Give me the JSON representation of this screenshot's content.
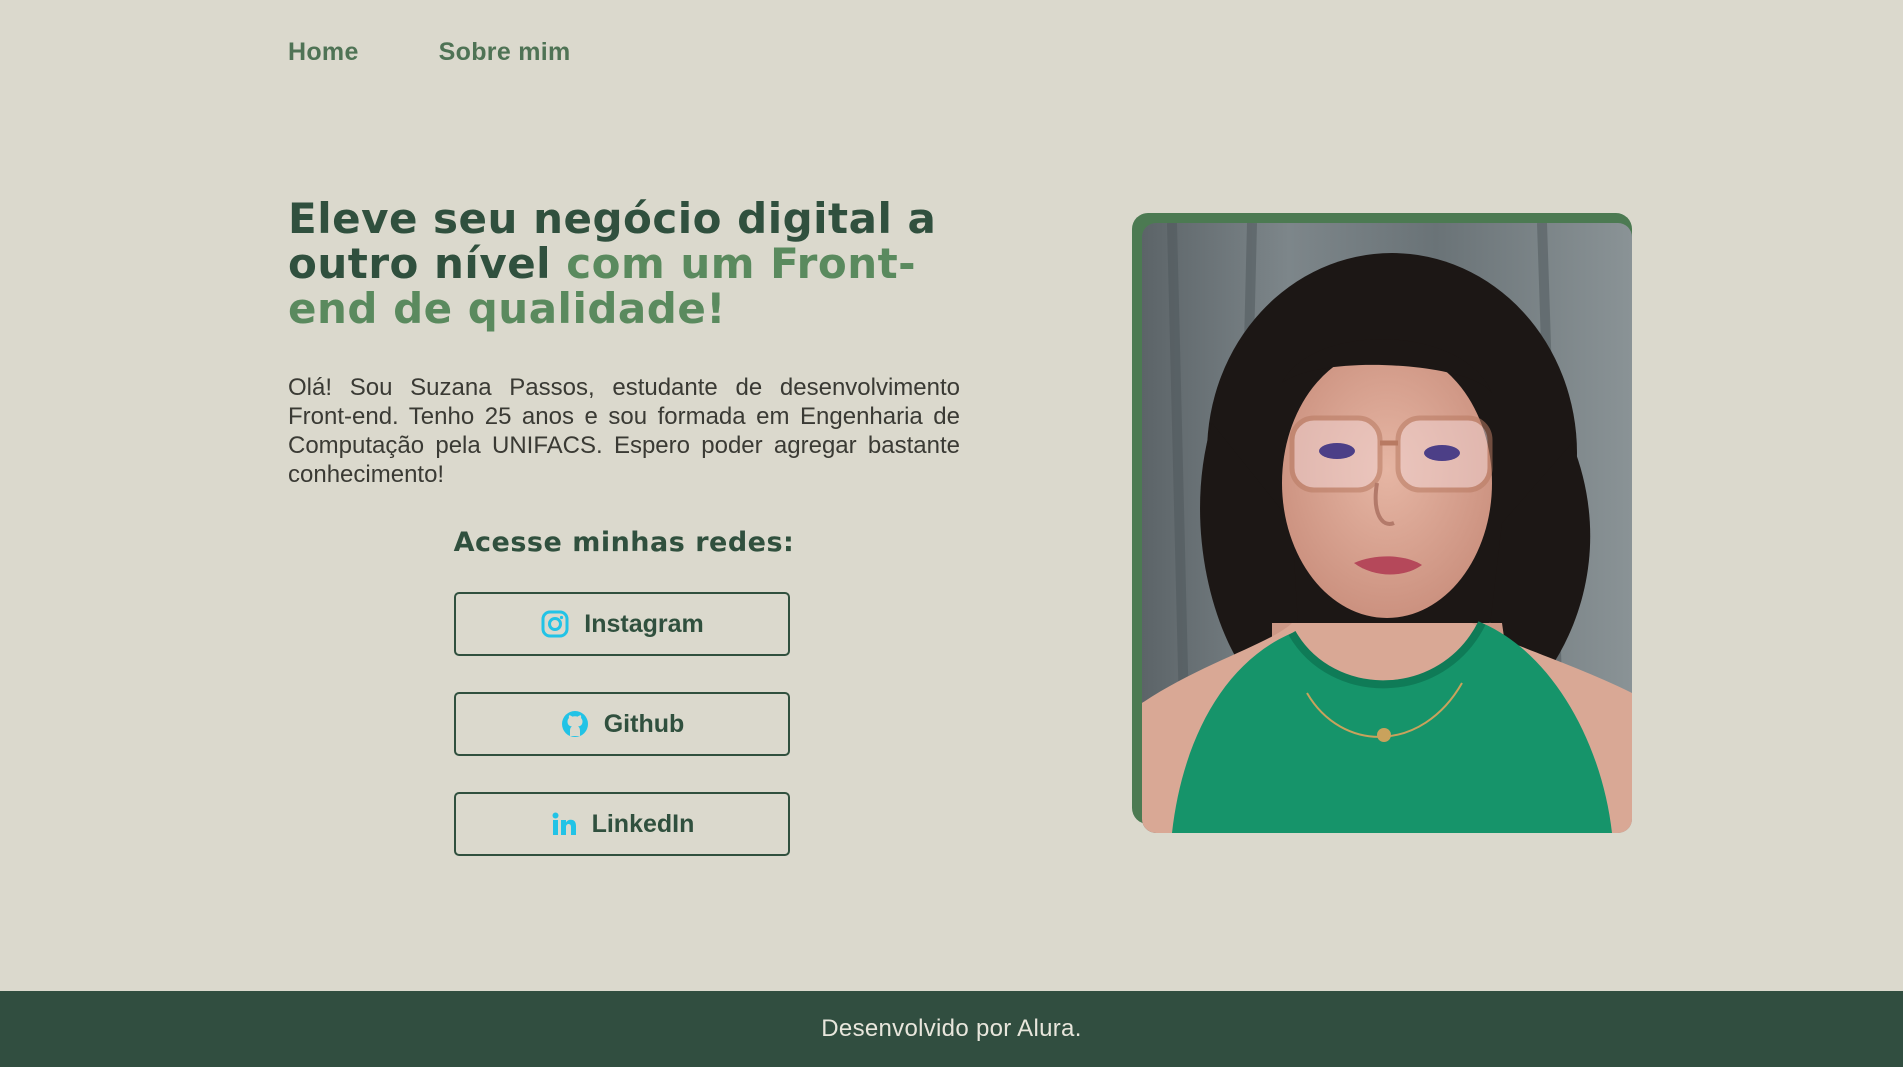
{
  "nav": {
    "items": [
      {
        "label": "Home"
      },
      {
        "label": "Sobre mim"
      }
    ]
  },
  "hero": {
    "headline_part1": "Eleve seu negócio digital a outro nível",
    "headline_part2": "com um Front-end de qualidade!",
    "bio": "Olá! Sou Suzana Passos, estudante de desenvolvimento Front-end. Tenho 25 anos e sou formada em Engenharia de Computação pela UNIFACS. Espero poder agregar bastante conhecimento!",
    "socials_title": "Acesse minhas redes:",
    "socials": [
      {
        "label": "Instagram",
        "icon": "instagram-icon"
      },
      {
        "label": "Github",
        "icon": "github-icon"
      },
      {
        "label": "LinkedIn",
        "icon": "linkedin-icon"
      }
    ],
    "photo_alt": "profile-photo"
  },
  "footer": {
    "text": "Desenvolvido por Alura."
  },
  "colors": {
    "background": "#dbd9cd",
    "primary_dark": "#30503e",
    "accent_green": "#5a8a5e",
    "icon_blue": "#22c3e6",
    "footer_bg": "#314e40"
  }
}
